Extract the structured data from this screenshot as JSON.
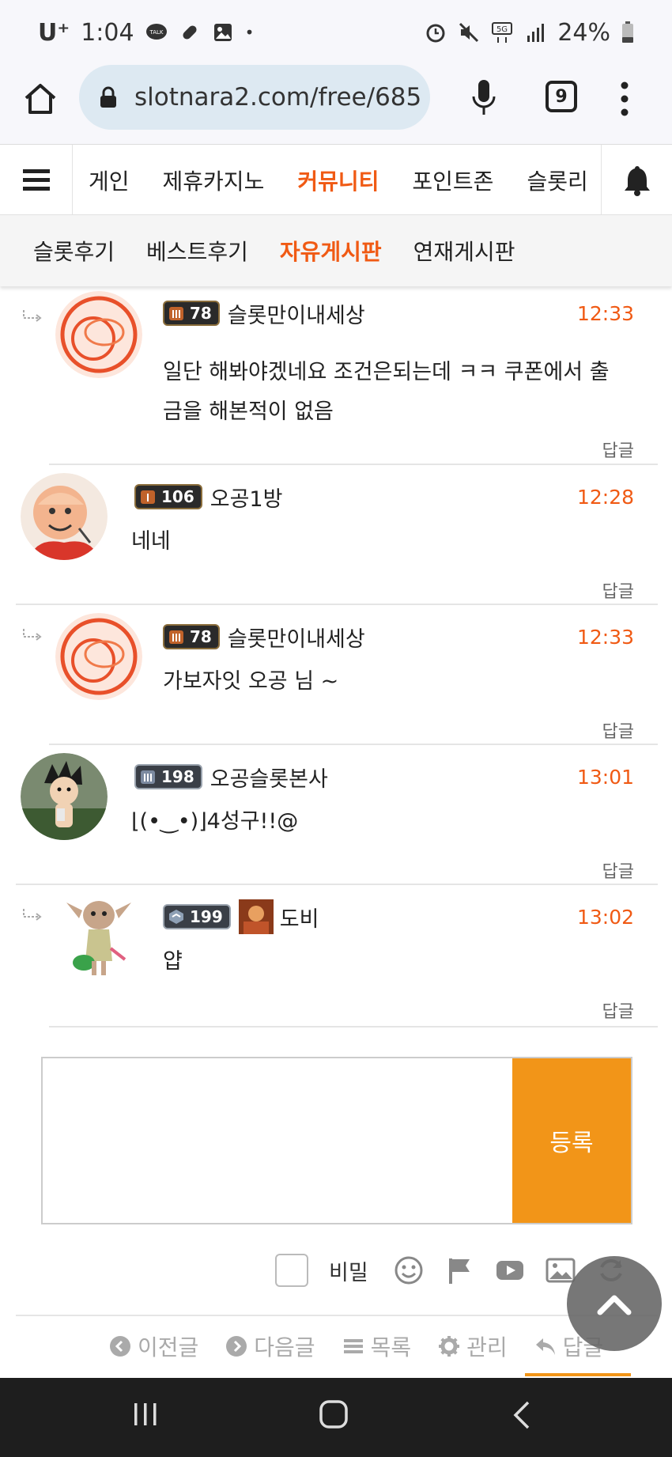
{
  "status_bar": {
    "carrier": "U⁺",
    "time": "1:04",
    "battery": "24%",
    "icons": [
      "kakaotalk-icon",
      "link-icon",
      "image-icon",
      "alarm-icon",
      "mute-icon",
      "5g-icon",
      "signal-icon",
      "battery-icon"
    ]
  },
  "browser": {
    "url": "slotnara2.com/free/685",
    "tab_count": "9"
  },
  "top_nav": {
    "items": [
      "게인",
      "제휴카지노",
      "커뮤니티",
      "포인트존",
      "슬롯리"
    ],
    "active_index": 2
  },
  "sub_nav": {
    "items": [
      "슬롯후기",
      "베스트후기",
      "자유게시판",
      "연재게시판"
    ],
    "active_index": 2
  },
  "comments": [
    {
      "is_reply": true,
      "level": "78",
      "nickname": "슬롯만이내세상",
      "time": "12:33",
      "text_line1": "일단 해봐야겠네요 조건은되는데 ㅋㅋ 쿠폰에서 출",
      "text_line2": "금을 해본적이 없음",
      "reply_label": "답글"
    },
    {
      "is_reply": false,
      "level": "106",
      "nickname": "오공1방",
      "time": "12:28",
      "text_line1": "네네",
      "reply_label": "답글"
    },
    {
      "is_reply": true,
      "level": "78",
      "nickname": "슬롯만이내세상",
      "time": "12:33",
      "text_line1": "가보자잇 오공 님 ~",
      "reply_label": "답글"
    },
    {
      "is_reply": false,
      "level": "198",
      "nickname": "오공슬롯본사",
      "time": "13:01",
      "text_line1": "⌊(•‿•)⌋4성구!!@",
      "reply_label": "답글"
    },
    {
      "is_reply": true,
      "level": "199",
      "nickname": "도비",
      "time": "13:02",
      "text_line1": "얍",
      "reply_label": "답글"
    }
  ],
  "editor": {
    "submit_label": "등록",
    "secret_label": "비밀"
  },
  "bottom_actions": {
    "prev": "이전글",
    "next": "다음글",
    "list": "목록",
    "manage": "관리",
    "reply": "답글"
  },
  "colors": {
    "accent": "#f05a14",
    "submit": "#f29518"
  }
}
